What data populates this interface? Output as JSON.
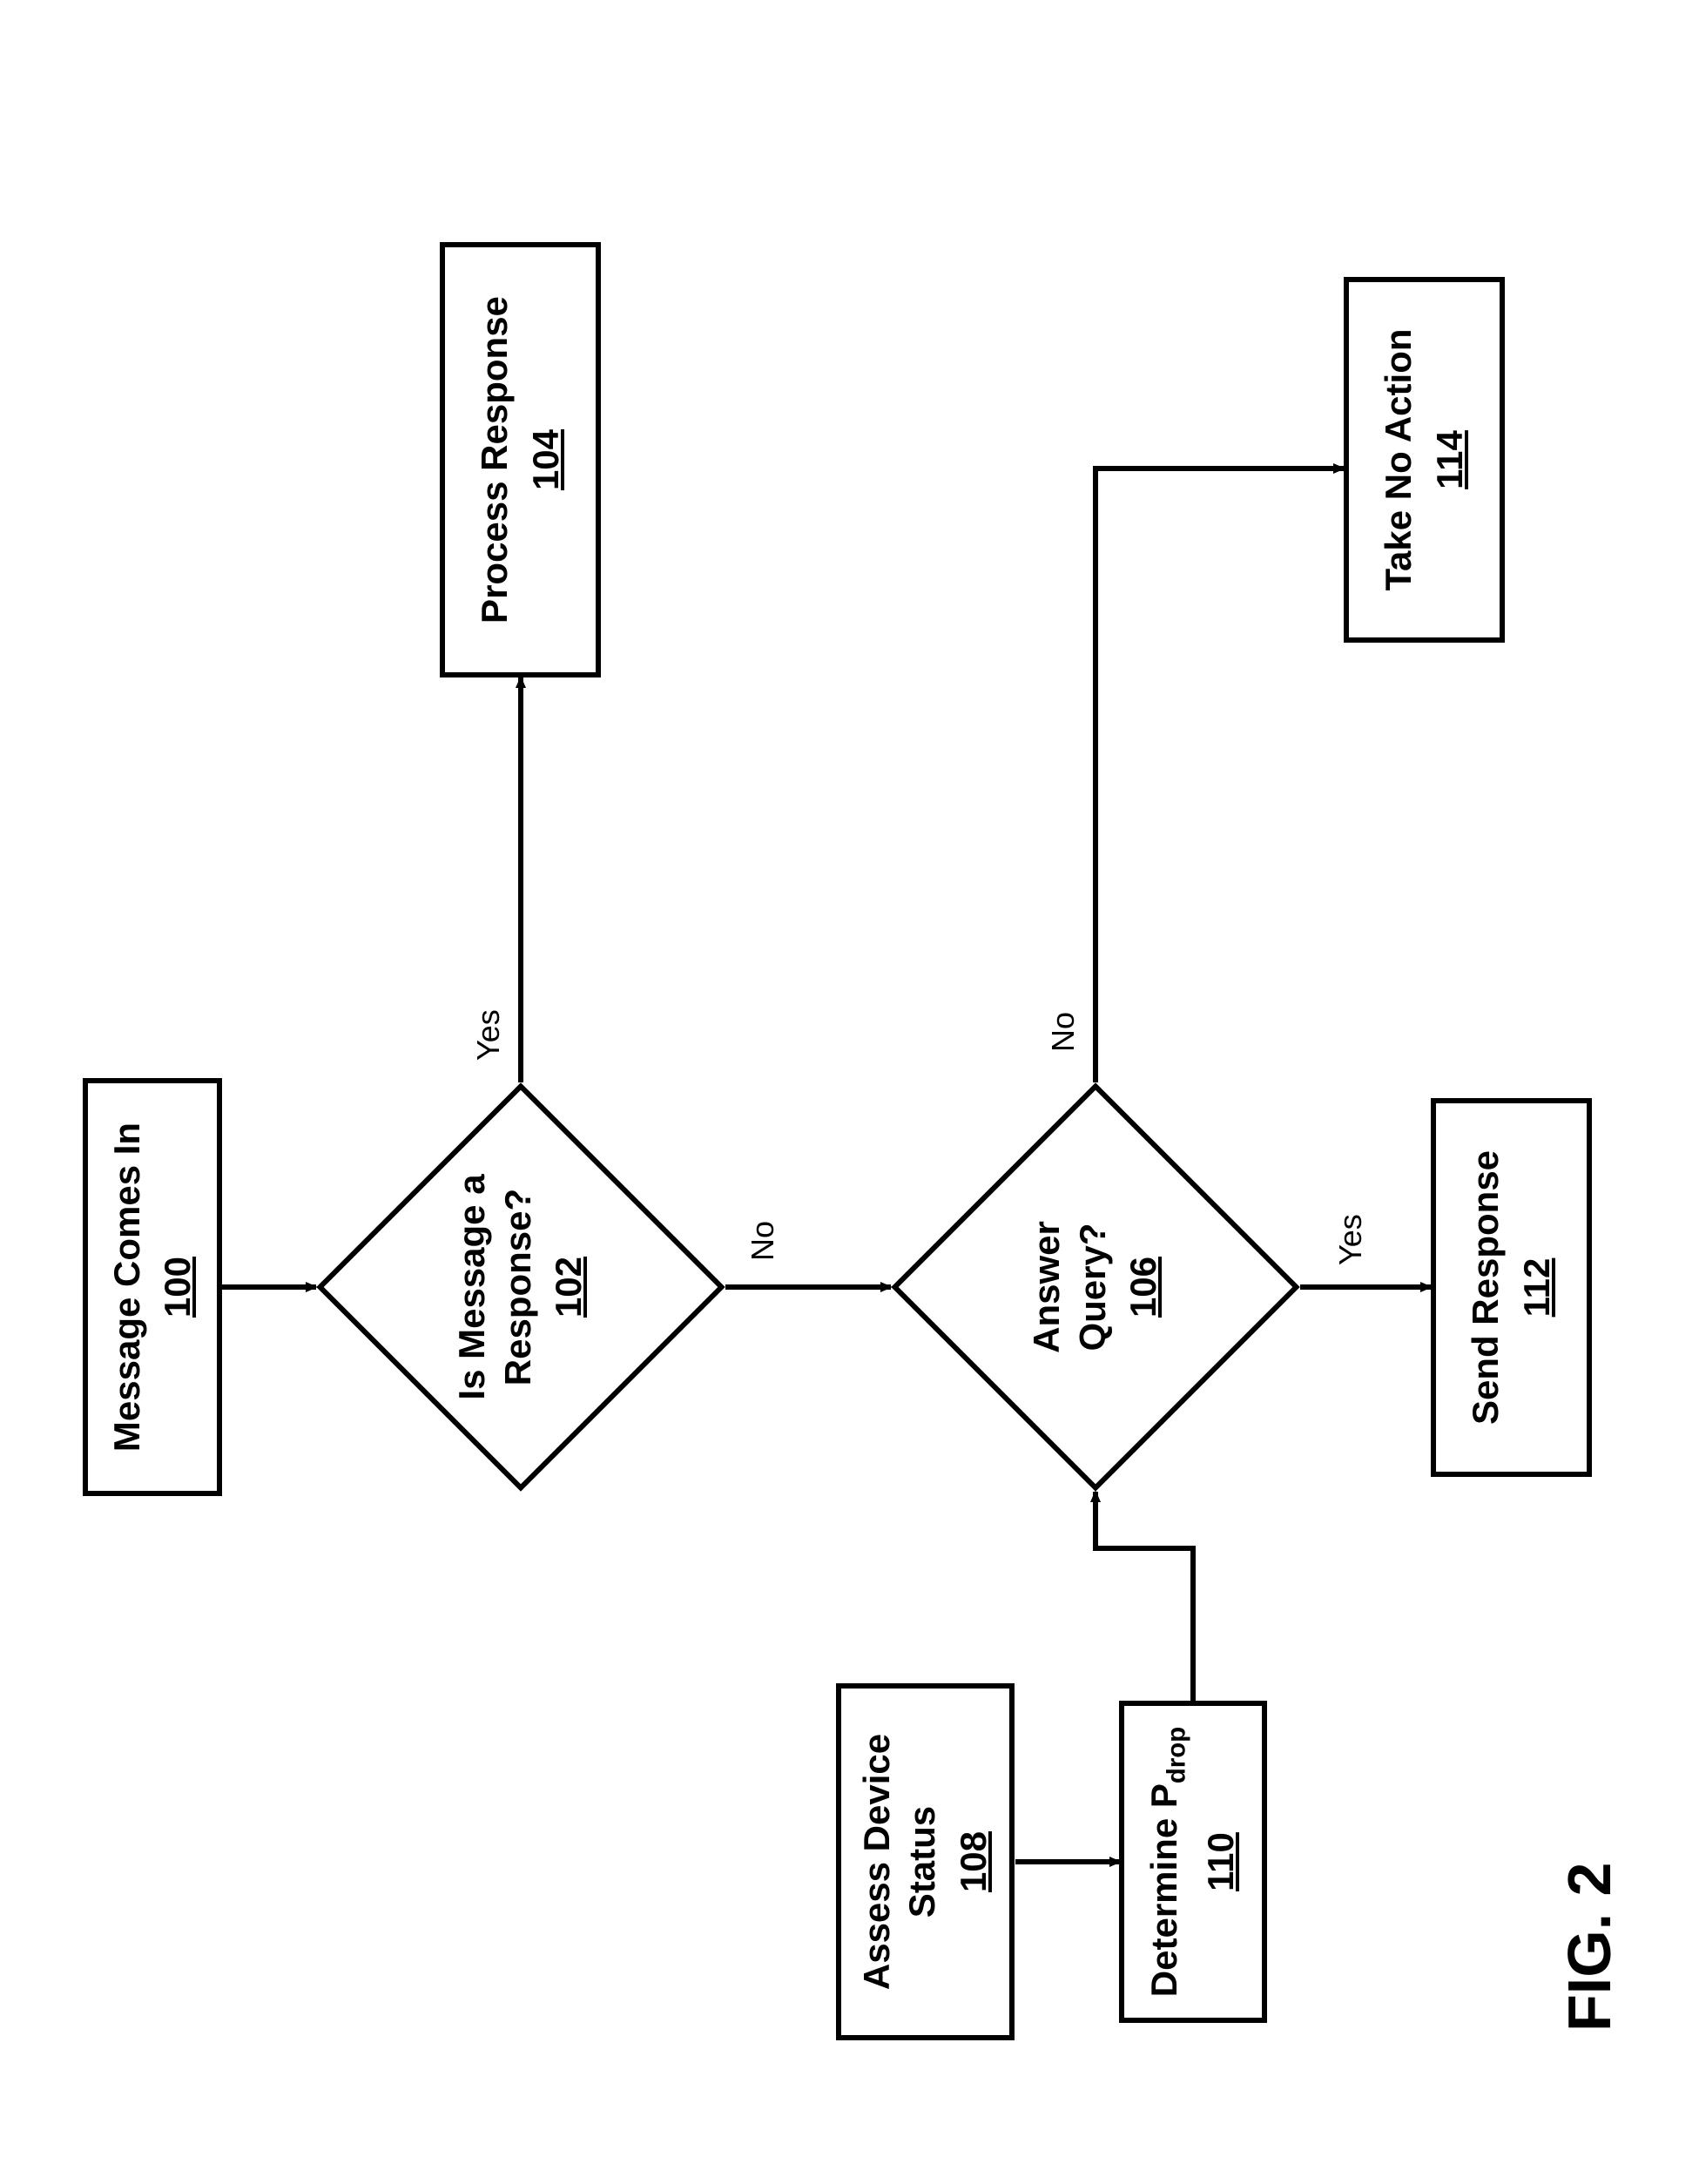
{
  "figure_label": "FIG. 2",
  "nodes": {
    "n100": {
      "line1": "Message Comes In",
      "ref": "100"
    },
    "n102": {
      "line1": "Is Message a",
      "line2": "Response?",
      "ref": "102"
    },
    "n104": {
      "line1": "Process Response",
      "ref": "104"
    },
    "n106": {
      "line1": "Answer",
      "line2": "Query?",
      "ref": "106"
    },
    "n108": {
      "line1": "Assess Device",
      "line2": "Status",
      "ref": "108"
    },
    "n110": {
      "line1_prefix": "Determine P",
      "line1_sub": "drop",
      "ref": "110"
    },
    "n112": {
      "line1": "Send Response",
      "ref": "112"
    },
    "n114": {
      "line1": "Take No Action",
      "ref": "114"
    }
  },
  "edges": {
    "e102_yes": "Yes",
    "e102_no": "No",
    "e106_yes": "Yes",
    "e106_no": "No"
  }
}
